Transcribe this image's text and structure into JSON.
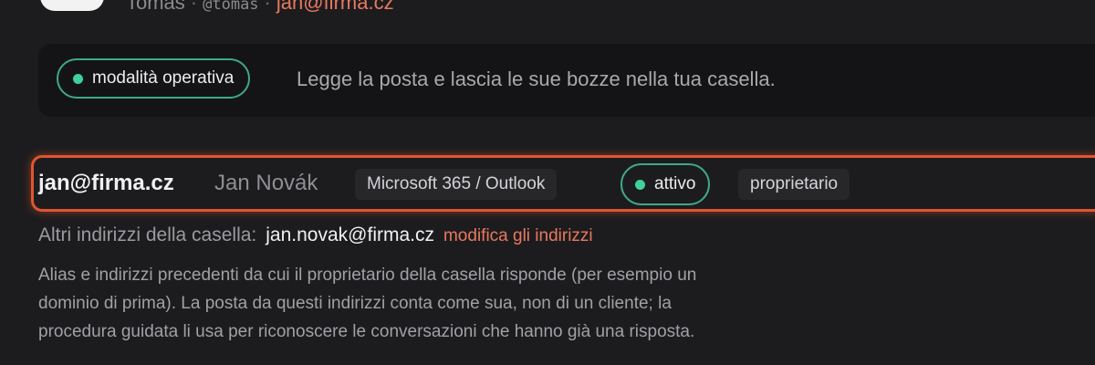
{
  "profile": {
    "name": "Tomas",
    "handle": "@tomas",
    "separator": "·",
    "email": "jan@firma.cz"
  },
  "mode": {
    "badge_label": "modalità operativa",
    "description": "Legge la posta e lascia le sue bozze nella tua casella."
  },
  "mailbox": {
    "email": "jan@firma.cz",
    "owner_name": "Jan Novák",
    "provider": "Microsoft 365 / Outlook",
    "status": "attivo",
    "role": "proprietario"
  },
  "aliases": {
    "label": "Altri indirizzi della casella:",
    "value": "jan.novak@firma.cz",
    "edit_link": "modifica gli indirizzi",
    "help": "Alias e indirizzi precedenti da cui il proprietario della casella risponde (per esempio un dominio di prima). La posta da questi indirizzi conta come sua, non di un cliente; la procedura guidata li usa per riconoscere le conversazioni che hanno già una risposta."
  },
  "colors": {
    "accent": "#e8785f",
    "status_green": "#3fd09b",
    "highlight": "#e0552f"
  }
}
